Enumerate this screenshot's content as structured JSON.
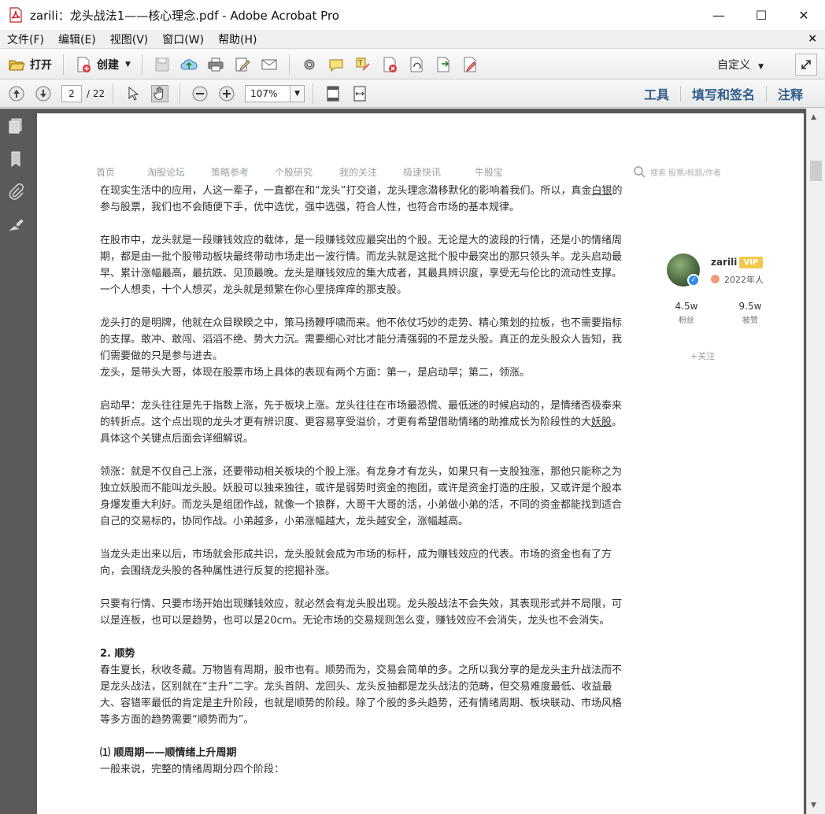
{
  "window": {
    "title": "zarili：龙头战法1——核心理念.pdf - Adobe Acrobat Pro",
    "minimize": "—",
    "maximize": "☐",
    "close": "✕"
  },
  "menu": {
    "items": [
      "文件(F)",
      "编辑(E)",
      "视图(V)",
      "窗口(W)",
      "帮助(H)"
    ],
    "close": "×"
  },
  "toolbar": {
    "open_label": "打开",
    "create_label": "创建",
    "customize_label": "自定义"
  },
  "nav": {
    "current_page": "2",
    "total_pages": "/ 22",
    "zoom": "107%",
    "tools_label": "工具",
    "fill_sign_label": "填写和签名",
    "comment_label": "注释"
  },
  "web": {
    "nav_items": [
      "首页",
      "淘股论坛",
      "策略参考",
      "个股研究",
      "我的关注",
      "极速快讯",
      "牛股宝"
    ],
    "search_placeholder": "搜索 股票/标题/作者"
  },
  "article": {
    "p1_pre": "在现实生活中的应用，人这一辈子，一直都在和“龙头”打交道，龙头理念潜移默化的影响着我们。所以，真金",
    "p1_u": "白银",
    "p1_post": "的参与股票，我们也不会随便下手，优中选优，强中选强，符合人性，也符合市场的基本规律。",
    "p2": "在股市中，龙头就是一段赚钱效应的载体，是一段赚钱效应最突出的个股。无论是大的波段的行情，还是小的情绪周期，都是由一批个股带动板块最终带动市场走出一波行情。而龙头就是这批个股中最突出的那只领头羊。龙头启动最早、累计涨幅最高，最抗跌、见顶最晚。龙头是赚钱效应的集大成者，其最具辨识度，享受无与伦比的流动性支撑。一个人想卖，十个人想买，龙头就是频繁在你心里挠痒痒的那支股。",
    "p3": "龙头打的是明牌，他就在众目睽睽之中，策马扬鞭呼啸而来。他不依仗巧妙的走势、精心策划的拉板，也不需要指标的支撑。敢冲、敢闯、滔滔不绝、势大力沉。需要细心对比才能分清强弱的不是龙头股。真正的龙头股众人皆知，我们需要做的只是参与进去。",
    "p4": "龙头，是带头大哥，体现在股票市场上具体的表现有两个方面：第一，是启动早；第二，领涨。",
    "p5_pre": "启动早：龙头往往是先于指数上涨，先于板块上涨。龙头往往在市场最恐慌、最低迷的时候启动的，是情绪否极泰来的转折点。这个点出现的龙头才更有辨识度、更容易享受溢价，才更有希望借助情绪的助推成长为阶段性的大",
    "p5_u": "妖股",
    "p5_post": "。具体这个关键点后面会详细解说。",
    "p6": "领涨：就是不仅自己上涨，还要带动相关板块的个股上涨。有龙身才有龙头，如果只有一支股独涨，那他只能称之为独立妖股而不能叫龙头股。妖股可以独来独往，或许是弱势时资金的抱团，或许是资金打造的庄股，又或许是个股本身爆发重大利好。而龙头是组团作战，就像一个狼群，大哥干大哥的活，小弟做小弟的活，不同的资金都能找到适合自己的交易标的，协同作战。小弟越多，小弟涨幅越大，龙头越安全，涨幅越高。",
    "p7": "当龙头走出来以后，市场就会形成共识，龙头股就会成为市场的标杆，成为赚钱效应的代表。市场的资金也有了方向，会围绕龙头股的各种属性进行反复的挖掘补涨。",
    "p8": "只要有行情、只要市场开始出现赚钱效应，就必然会有龙头股出现。龙头股战法不会失效，其表现形式并不局限，可以是连板，也可以是趋势，也可以是20cm。无论市场的交易规则怎么变，赚钱效应不会消失，龙头也不会消失。",
    "h2": "2. 顺势",
    "p9": "春生夏长，秋收冬藏。万物皆有周期，股市也有。顺势而为，交易会简单的多。之所以我分享的是龙头主升战法而不是龙头战法，区别就在“主升”二字。龙头首阴、龙回头、龙头反抽都是龙头战法的范畴，但交易难度最低、收益最大、容错率最低的肯定是主升阶段，也就是顺势的阶段。除了个股的多头趋势，还有情绪周期、板块联动、市场风格等多方面的趋势需要“顺势而为”。",
    "h3": "⑴ 顺周期——顺情绪上升周期",
    "p10": "一般来说，完整的情绪周期分四个阶段："
  },
  "author": {
    "name": "zarili",
    "vip": "VIP",
    "badge": "2022年人",
    "fans_value": "4.5w",
    "fans_label": "粉丝",
    "likes_value": "9.5w",
    "likes_label": "被赞",
    "follow": "+关注"
  },
  "colors": {
    "link_blue": "#2f5d8a",
    "nav_gray": "#5a5a5a",
    "vip_gold": "#f2c94c"
  }
}
